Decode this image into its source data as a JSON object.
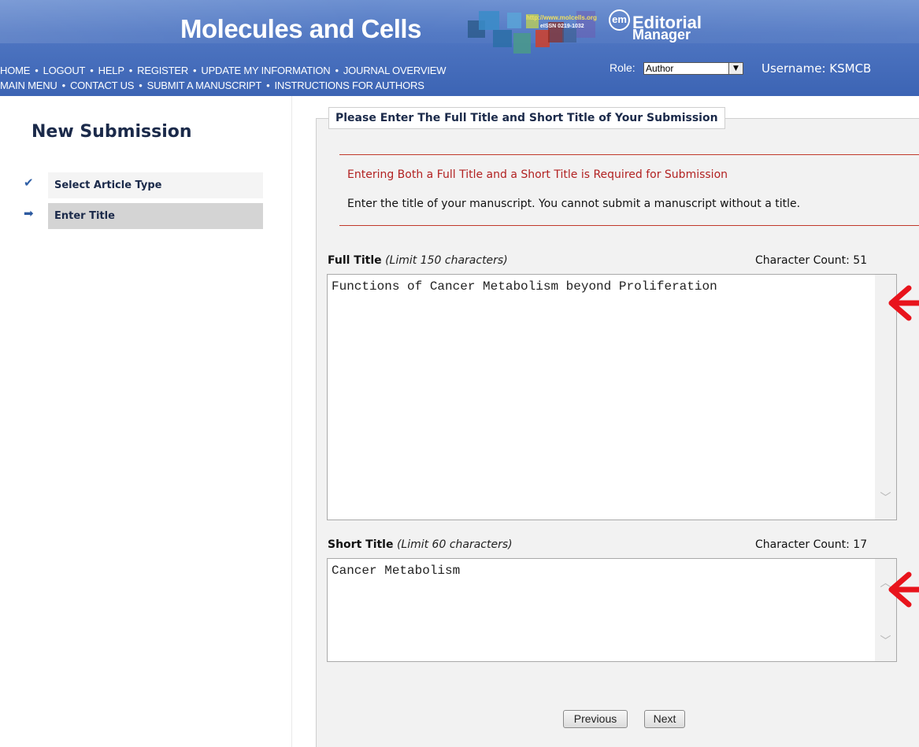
{
  "header": {
    "journal_title": "Molecules and Cells",
    "cover_url": "http://www.molcells.org",
    "cover_issn": "eISSN 0219-1032",
    "em_badge": "em",
    "em_word1": "Editorial",
    "em_word2": "Manager",
    "nav_row1": [
      "HOME",
      "LOGOUT",
      "HELP",
      "REGISTER",
      "UPDATE MY INFORMATION",
      "JOURNAL OVERVIEW"
    ],
    "nav_row2": [
      "MAIN MENU",
      "CONTACT US",
      "SUBMIT A MANUSCRIPT",
      "INSTRUCTIONS FOR AUTHORS"
    ],
    "role_label": "Role:",
    "role_value": "Author",
    "username": "Username: KSMCB"
  },
  "sidebar": {
    "heading": "New Submission",
    "steps": [
      {
        "label": "Select Article Type",
        "status": "done"
      },
      {
        "label": "Enter Title",
        "status": "current"
      }
    ]
  },
  "form": {
    "legend": "Please Enter The Full Title and Short Title of Your Submission",
    "notice_required": "Entering Both a Full Title and a Short Title is Required for Submission",
    "notice_instruction": "Enter the title of your manuscript. You cannot submit a manuscript without a title.",
    "full_title": {
      "label": "Full Title",
      "limit": "(Limit 150 characters)",
      "count_text": "Character Count: 51",
      "value": "Functions of Cancer Metabolism beyond Proliferation"
    },
    "short_title": {
      "label": "Short Title",
      "limit": "(Limit 60 characters)",
      "count_text": "Character Count: 17",
      "value": "Cancer Metabolism"
    },
    "previous_label": "Previous",
    "next_label": "Next"
  },
  "colors": {
    "header_blue": "#4f76c2",
    "required_red": "#b22222",
    "annotation_arrow": "#e8141c"
  }
}
